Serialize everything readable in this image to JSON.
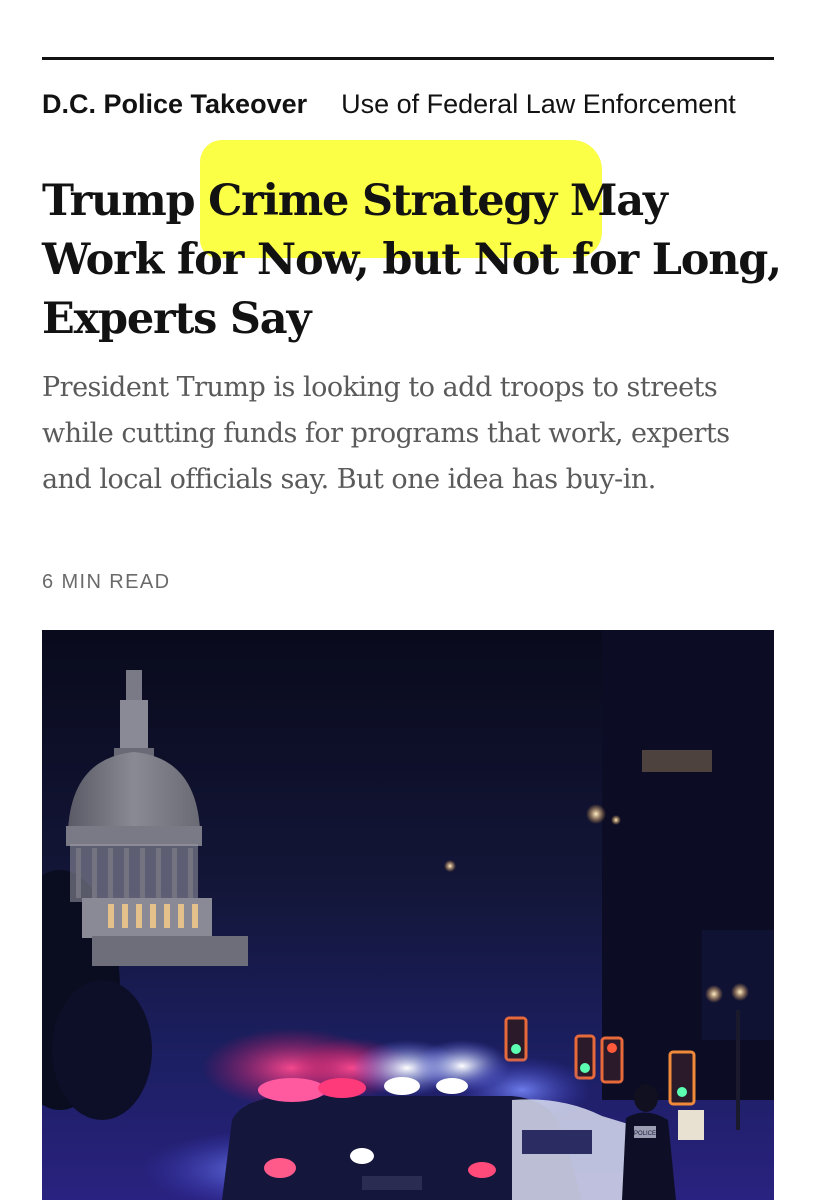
{
  "section_bar": {
    "label": "D.C. Police Takeover",
    "link": "Use of Federal Law Enforcement"
  },
  "article": {
    "headline": "Trump Crime Strategy May Work for Now, but Not for Long, Experts Say",
    "highlighted_phrase": "Crime Strategy May",
    "summary": "President Trump is looking to add troops to streets while cutting funds for programs that work, experts and local officials say. But one idea has buy-in.",
    "read_time": "6 MIN READ",
    "highlight_color": "#fbff3c"
  },
  "photo": {
    "police_car_text": "POLICE"
  }
}
